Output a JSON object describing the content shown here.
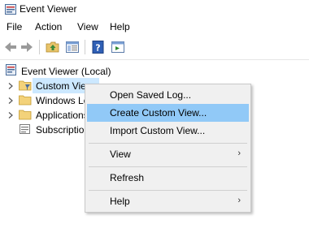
{
  "window": {
    "title": "Event Viewer"
  },
  "menubar": {
    "items": [
      "File",
      "Action",
      "View",
      "Help"
    ]
  },
  "toolbar": {
    "icons": [
      "back-arrow-icon",
      "forward-arrow-icon",
      "up-folder-icon",
      "show-hide-tree-icon",
      "help-icon",
      "properties-icon"
    ]
  },
  "tree": {
    "root": "Event Viewer (Local)",
    "items": [
      {
        "label": "Custom Views"
      },
      {
        "label": "Windows Logs"
      },
      {
        "label": "Applications and Services Logs"
      },
      {
        "label": "Subscriptions"
      }
    ]
  },
  "context_menu": {
    "items": [
      {
        "label": "Open Saved Log...",
        "submenu": false
      },
      {
        "label": "Create Custom View...",
        "submenu": false,
        "highlighted": true
      },
      {
        "label": "Import Custom View...",
        "submenu": false
      },
      {
        "label": "View",
        "submenu": true
      },
      {
        "label": "Refresh",
        "submenu": false
      },
      {
        "label": "Help",
        "submenu": true
      }
    ]
  },
  "colors": {
    "selection": "#cce8ff",
    "menu_highlight": "#91c9f7",
    "menu_bg": "#f0f0f0"
  }
}
